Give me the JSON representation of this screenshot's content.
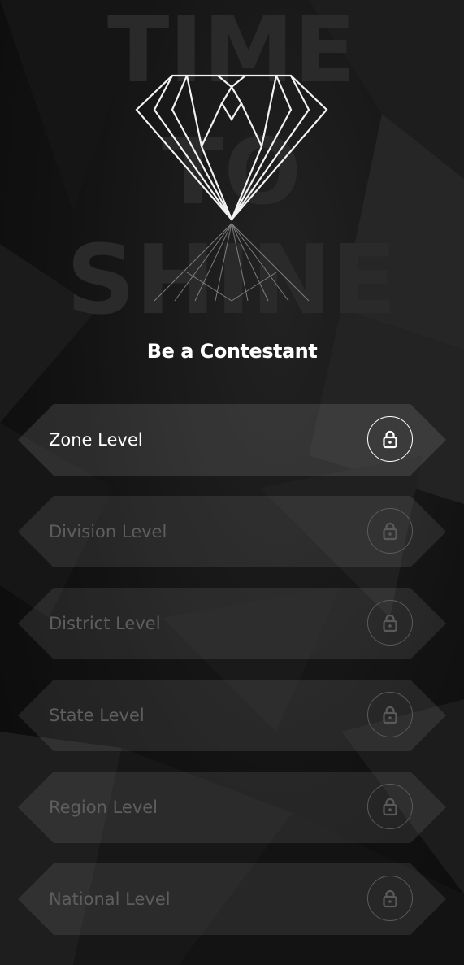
{
  "watermark": {
    "line1": "TIME",
    "line2": "TO",
    "line3": "SHINE"
  },
  "heading": "Be a Contestant",
  "colors": {
    "active_text": "#ffffff",
    "locked_text": "#5e5e5e",
    "background": "#121212"
  },
  "levels": [
    {
      "label": "Zone Level",
      "state": "active",
      "icon": "lock-icon"
    },
    {
      "label": "Division Level",
      "state": "locked",
      "icon": "lock-icon"
    },
    {
      "label": "District Level",
      "state": "locked",
      "icon": "lock-icon"
    },
    {
      "label": "State Level",
      "state": "locked",
      "icon": "lock-icon"
    },
    {
      "label": "Region Level",
      "state": "locked",
      "icon": "lock-icon"
    },
    {
      "label": "National Level",
      "state": "locked",
      "icon": "lock-icon"
    }
  ]
}
